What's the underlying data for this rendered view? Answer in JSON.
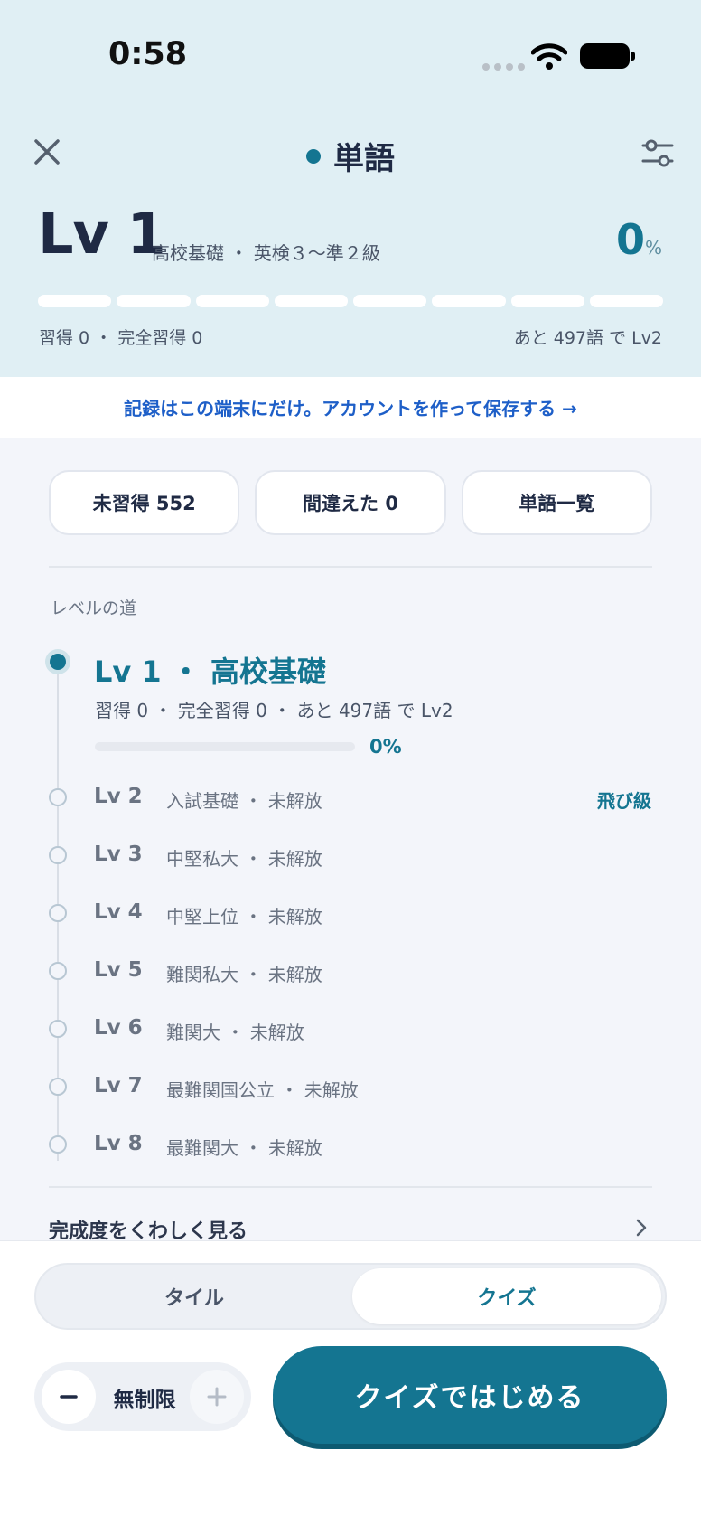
{
  "status_bar": {
    "time": "0:58"
  },
  "header": {
    "title": "単語",
    "level_label": "Lv 1",
    "level_sub": "高校基礎 ・ 英検３～準２級",
    "percent": "0",
    "percent_sign": "%",
    "progress_stats": "習得 0 ・ 完全習得 0",
    "next_level_text": "あと 497語 で Lv2",
    "segments": 8
  },
  "banner": {
    "text": "記録はこの端末にだけ。アカウントを作って保存する →"
  },
  "chips": {
    "unlearned": "未習得 552",
    "mistakes": "間違えた 0",
    "word_list": "単語一覧"
  },
  "path": {
    "section_label": "レベルの道",
    "current": {
      "title": "Lv 1 ・ 高校基礎",
      "stats": "習得 0 ・ 完全習得 0 ・ あと 497語 で Lv2",
      "percent_label": "0%",
      "progress": 0
    },
    "levels": [
      {
        "num": "Lv 2",
        "desc": "入試基礎 ・ 未解放",
        "skip": "飛び級"
      },
      {
        "num": "Lv 3",
        "desc": "中堅私大 ・ 未解放"
      },
      {
        "num": "Lv 4",
        "desc": "中堅上位 ・ 未解放"
      },
      {
        "num": "Lv 5",
        "desc": "難関私大 ・ 未解放"
      },
      {
        "num": "Lv 6",
        "desc": "難関大 ・ 未解放"
      },
      {
        "num": "Lv 7",
        "desc": "最難関国公立 ・ 未解放"
      },
      {
        "num": "Lv 8",
        "desc": "最難関大 ・ 未解放"
      }
    ],
    "detail_link": "完成度をくわしく見る"
  },
  "bottom": {
    "mode_tile": "タイル",
    "mode_quiz": "クイズ",
    "selected_mode": "クイズ",
    "stepper_value": "無制限",
    "start_button": "クイズではじめる"
  },
  "colors": {
    "accent": "#147591",
    "header_bg": "#e0eff4",
    "link": "#1e5fc8",
    "page_bg": "#f3f5fa"
  }
}
